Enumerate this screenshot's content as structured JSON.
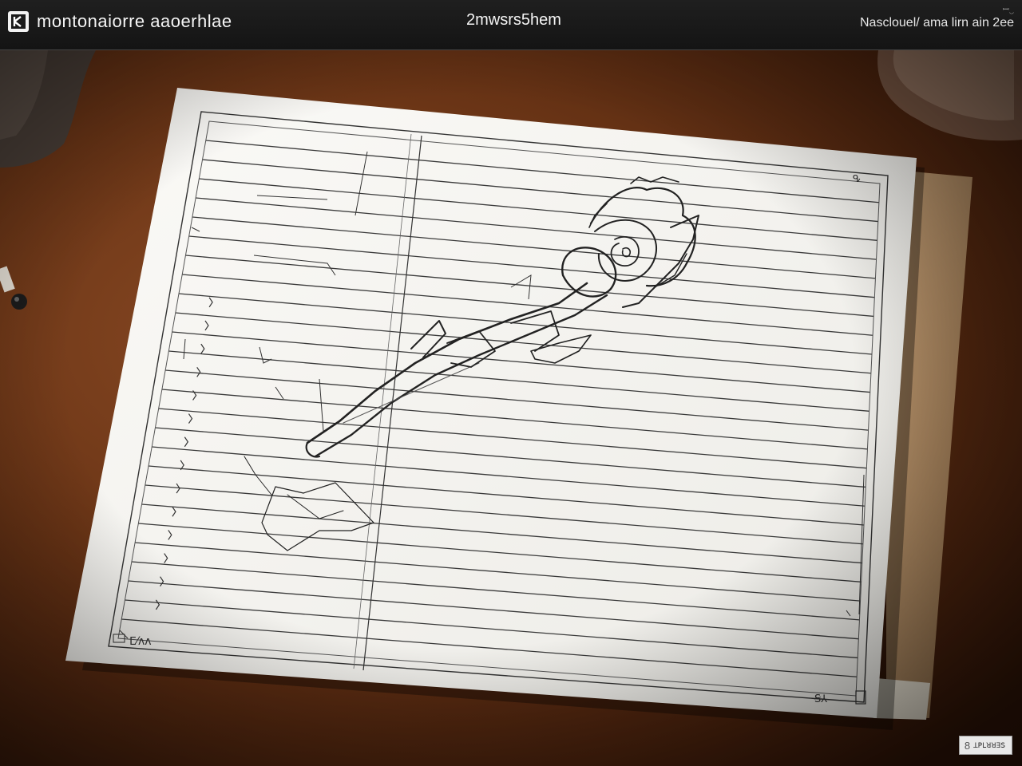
{
  "window": {
    "app_icon": "sketch-app-icon",
    "app_title": "montonaiorre aaoerhlae",
    "document_title": "2mwsrs5hem",
    "status_text": "Nasclouel/ ama lirn ain 2ee",
    "corner_mark": "ꟷ‿"
  },
  "canvas": {
    "content": "hand-drawn sketch of a rose on ruled notebook paper",
    "paper_corner_label": "ⵎ⁄ᴧᴧ",
    "paper_bottom_label": "Ꞩ⅄",
    "margin_marks": [
      "ᕴ",
      "ꓷ",
      "ꖎ"
    ]
  },
  "watermark": {
    "glyph": "8",
    "label": "ꓕꓑꓡꓤꓤꓱꓢ"
  },
  "colors": {
    "titlebar": "#1a1a1a",
    "desk": "#6b3516",
    "paper": "#f4f3ef",
    "ink": "#2a2a2a",
    "folder": "#b08a62"
  }
}
